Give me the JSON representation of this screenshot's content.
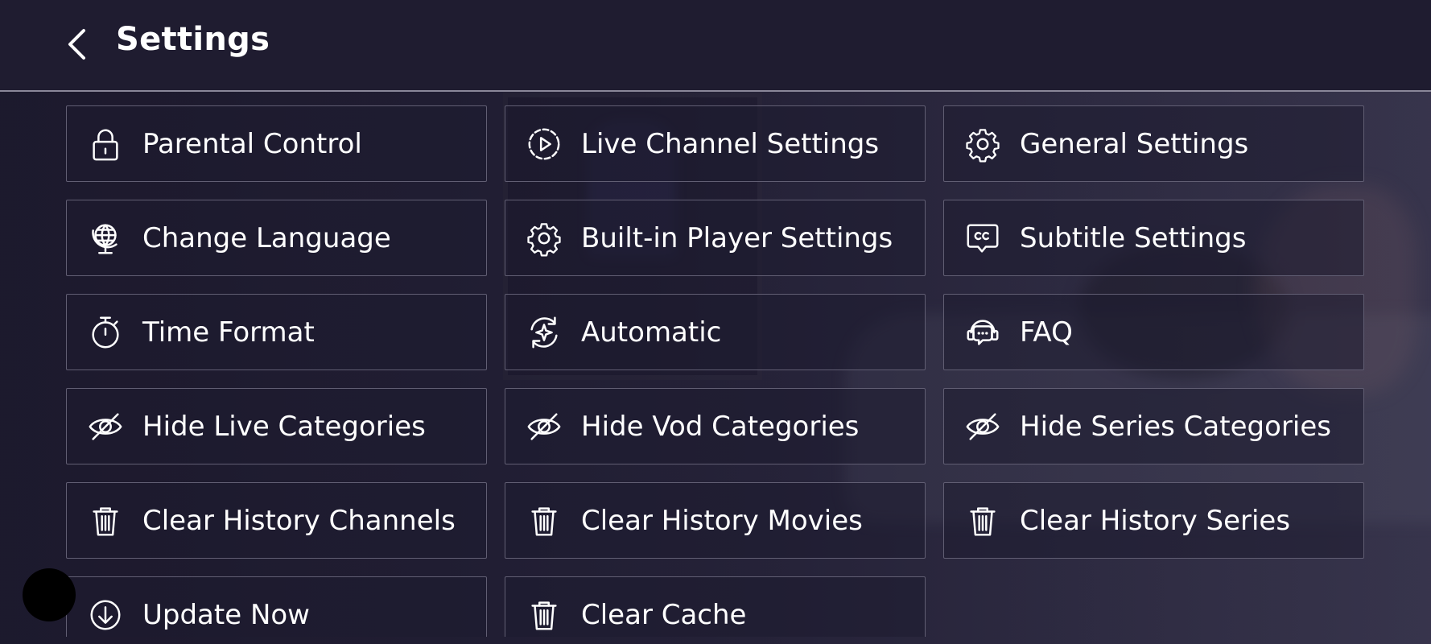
{
  "header": {
    "title": "Settings",
    "back_icon": "chevron-left-icon"
  },
  "tiles": [
    {
      "label": "Parental Control",
      "icon": "lock-icon"
    },
    {
      "label": "Live Channel Settings",
      "icon": "play-circle-icon"
    },
    {
      "label": "General Settings",
      "icon": "gear-icon"
    },
    {
      "label": "Change Language",
      "icon": "globe-icon"
    },
    {
      "label": "Built-in Player Settings",
      "icon": "gear-icon"
    },
    {
      "label": "Subtitle Settings",
      "icon": "cc-icon"
    },
    {
      "label": "Time Format",
      "icon": "stopwatch-icon"
    },
    {
      "label": "Automatic",
      "icon": "refresh-sparkle-icon"
    },
    {
      "label": "FAQ",
      "icon": "support-chat-icon"
    },
    {
      "label": "Hide Live Categories",
      "icon": "eye-off-icon"
    },
    {
      "label": "Hide Vod Categories",
      "icon": "eye-off-icon"
    },
    {
      "label": "Hide Series Categories",
      "icon": "eye-off-icon"
    },
    {
      "label": "Clear History Channels",
      "icon": "trash-icon"
    },
    {
      "label": "Clear History Movies",
      "icon": "trash-icon"
    },
    {
      "label": "Clear History Series",
      "icon": "trash-icon"
    },
    {
      "label": "Update Now",
      "icon": "download-circle-icon"
    },
    {
      "label": "Clear Cache",
      "icon": "trash-icon"
    }
  ],
  "colors": {
    "background": "#26233a",
    "header_bg": "#1f1c30",
    "tile_border": "#615e73",
    "text": "#ffffff"
  }
}
